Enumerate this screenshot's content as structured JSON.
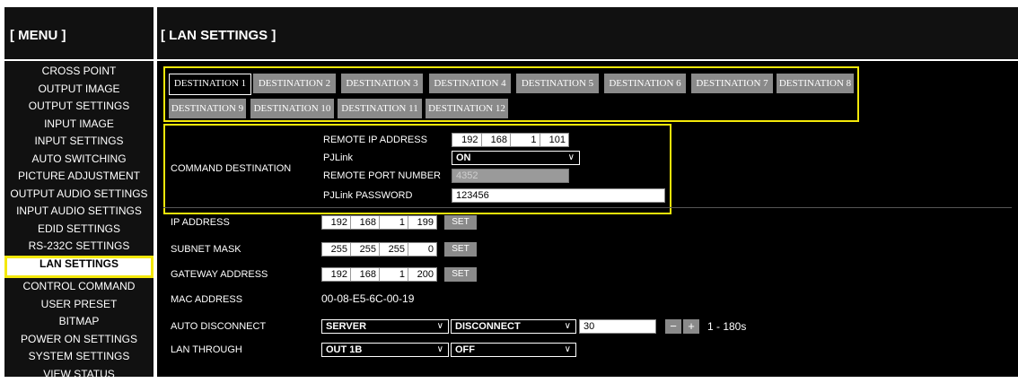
{
  "menu": {
    "title": "[ MENU ]",
    "items": [
      {
        "label": "CROSS POINT"
      },
      {
        "label": "OUTPUT IMAGE"
      },
      {
        "label": "OUTPUT SETTINGS"
      },
      {
        "label": "INPUT IMAGE"
      },
      {
        "label": "INPUT SETTINGS"
      },
      {
        "label": "AUTO SWITCHING"
      },
      {
        "label": "PICTURE ADJUSTMENT"
      },
      {
        "label": "OUTPUT AUDIO SETTINGS"
      },
      {
        "label": "INPUT AUDIO SETTINGS"
      },
      {
        "label": "EDID SETTINGS"
      },
      {
        "label": "RS-232C SETTINGS"
      },
      {
        "label": "LAN SETTINGS"
      },
      {
        "label": "CONTROL COMMAND"
      },
      {
        "label": "USER PRESET"
      },
      {
        "label": "BITMAP"
      },
      {
        "label": "POWER ON SETTINGS"
      },
      {
        "label": "SYSTEM SETTINGS"
      },
      {
        "label": "VIEW STATUS"
      }
    ],
    "active": "LAN SETTINGS"
  },
  "page": {
    "title": "[ LAN SETTINGS ]"
  },
  "tabs": [
    "DESTINATION 1",
    "DESTINATION 2",
    "DESTINATION 3",
    "DESTINATION 4",
    "DESTINATION 5",
    "DESTINATION 6",
    "DESTINATION 7",
    "DESTINATION 8",
    "DESTINATION 9",
    "DESTINATION 10",
    "DESTINATION 11",
    "DESTINATION 12"
  ],
  "active_tab": "DESTINATION 1",
  "command_destination": {
    "label": "COMMAND DESTINATION",
    "remote_ip_label": "REMOTE IP ADDRESS",
    "remote_ip": [
      "192",
      "168",
      "1",
      "101"
    ],
    "pjlink_label": "PJLink",
    "pjlink_value": "ON",
    "remote_port_label": "REMOTE PORT NUMBER",
    "remote_port_value": "4352",
    "pjlink_password_label": "PJLink PASSWORD",
    "pjlink_password_value": "123456"
  },
  "network": {
    "ip_label": "IP ADDRESS",
    "ip": [
      "192",
      "168",
      "1",
      "199"
    ],
    "subnet_label": "SUBNET MASK",
    "subnet": [
      "255",
      "255",
      "255",
      "0"
    ],
    "gateway_label": "GATEWAY ADDRESS",
    "gateway": [
      "192",
      "168",
      "1",
      "200"
    ],
    "set_label": "SET",
    "mac_label": "MAC ADDRESS",
    "mac_value": "00-08-E5-6C-00-19",
    "auto_disconnect_label": "AUTO DISCONNECT",
    "auto_disconnect_mode": "SERVER",
    "auto_disconnect_action": "DISCONNECT",
    "auto_disconnect_seconds": "30",
    "minus": "−",
    "plus": "+",
    "range": "1 - 180s",
    "lan_through_label": "LAN THROUGH",
    "lan_through_port": "OUT 1B",
    "lan_through_value": "OFF"
  },
  "colors": {
    "highlight": "#f4e80a",
    "tab_inactive": "#8a8a8a",
    "background": "#000000"
  }
}
